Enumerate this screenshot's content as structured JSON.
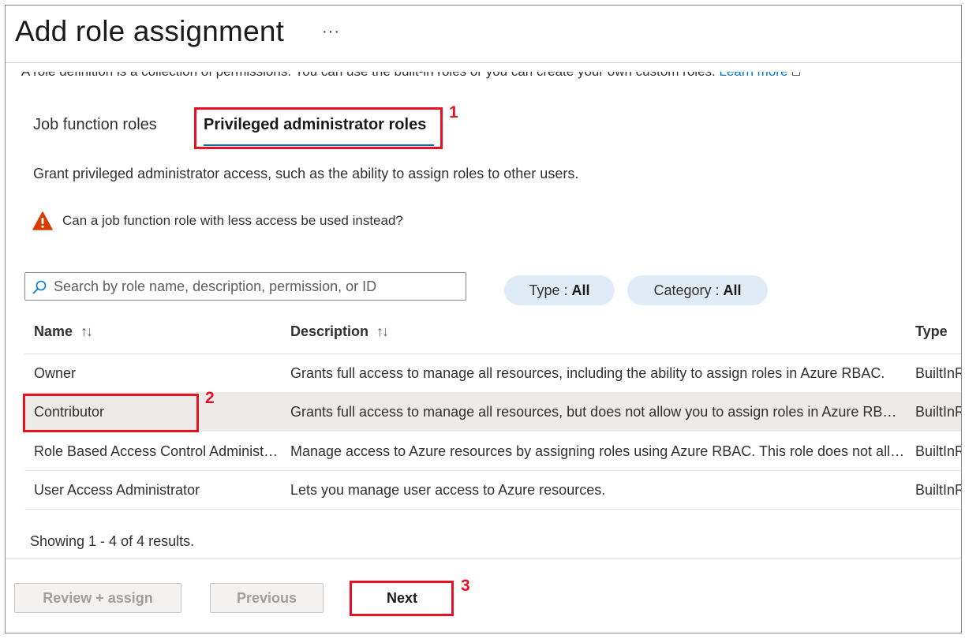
{
  "header": {
    "title": "Add role assignment",
    "more_label": "···"
  },
  "intro": {
    "text": "A role definition is a collection of permissions. You can use the built-in roles or you can create your own custom roles. ",
    "link": "Learn more"
  },
  "tabs": [
    {
      "label": "Job function roles",
      "selected": false
    },
    {
      "label": "Privileged administrator roles",
      "selected": true
    }
  ],
  "description": "Grant privileged administrator access, such as the ability to assign roles to other users.",
  "warning": {
    "text": "Can a job function role with less access be used instead?",
    "icon": "warning-icon",
    "color": "#d83b01"
  },
  "search": {
    "placeholder": "Search by role name, description, permission, or ID",
    "value": ""
  },
  "filters": [
    {
      "label": "Type : ",
      "value": "All"
    },
    {
      "label": "Category : ",
      "value": "All"
    }
  ],
  "table": {
    "columns": [
      "Name",
      "Description",
      "Type"
    ],
    "sort_indicator": "↑↓",
    "rows": [
      {
        "name": "Owner",
        "description": "Grants full access to manage all resources, including the ability to assign roles in Azure RBAC.",
        "type": "BuiltInRole"
      },
      {
        "name": "Contributor",
        "description": "Grants full access to manage all resources, but does not allow you to assign roles in Azure RBAC.",
        "type": "BuiltInRole"
      },
      {
        "name": "Role Based Access Control Administrator",
        "description": "Manage access to Azure resources by assigning roles using Azure RBAC. This role does not allow you to manage access using other ways.",
        "type": "BuiltInRole"
      },
      {
        "name": "User Access Administrator",
        "description": "Lets you manage user access to Azure resources.",
        "type": "BuiltInRole"
      }
    ],
    "selected_row": 1
  },
  "results": "Showing 1 - 4 of 4 results.",
  "footer": {
    "review_label": "Review + assign",
    "previous_label": "Previous",
    "next_label": "Next"
  },
  "annotations": {
    "step1": "1",
    "step2": "2",
    "step3": "3",
    "color": "#e81123"
  },
  "colors": {
    "accent": "#0f6cbd",
    "pill_bg": "#dfecf7",
    "selected_row_bg": "#edebe9"
  }
}
